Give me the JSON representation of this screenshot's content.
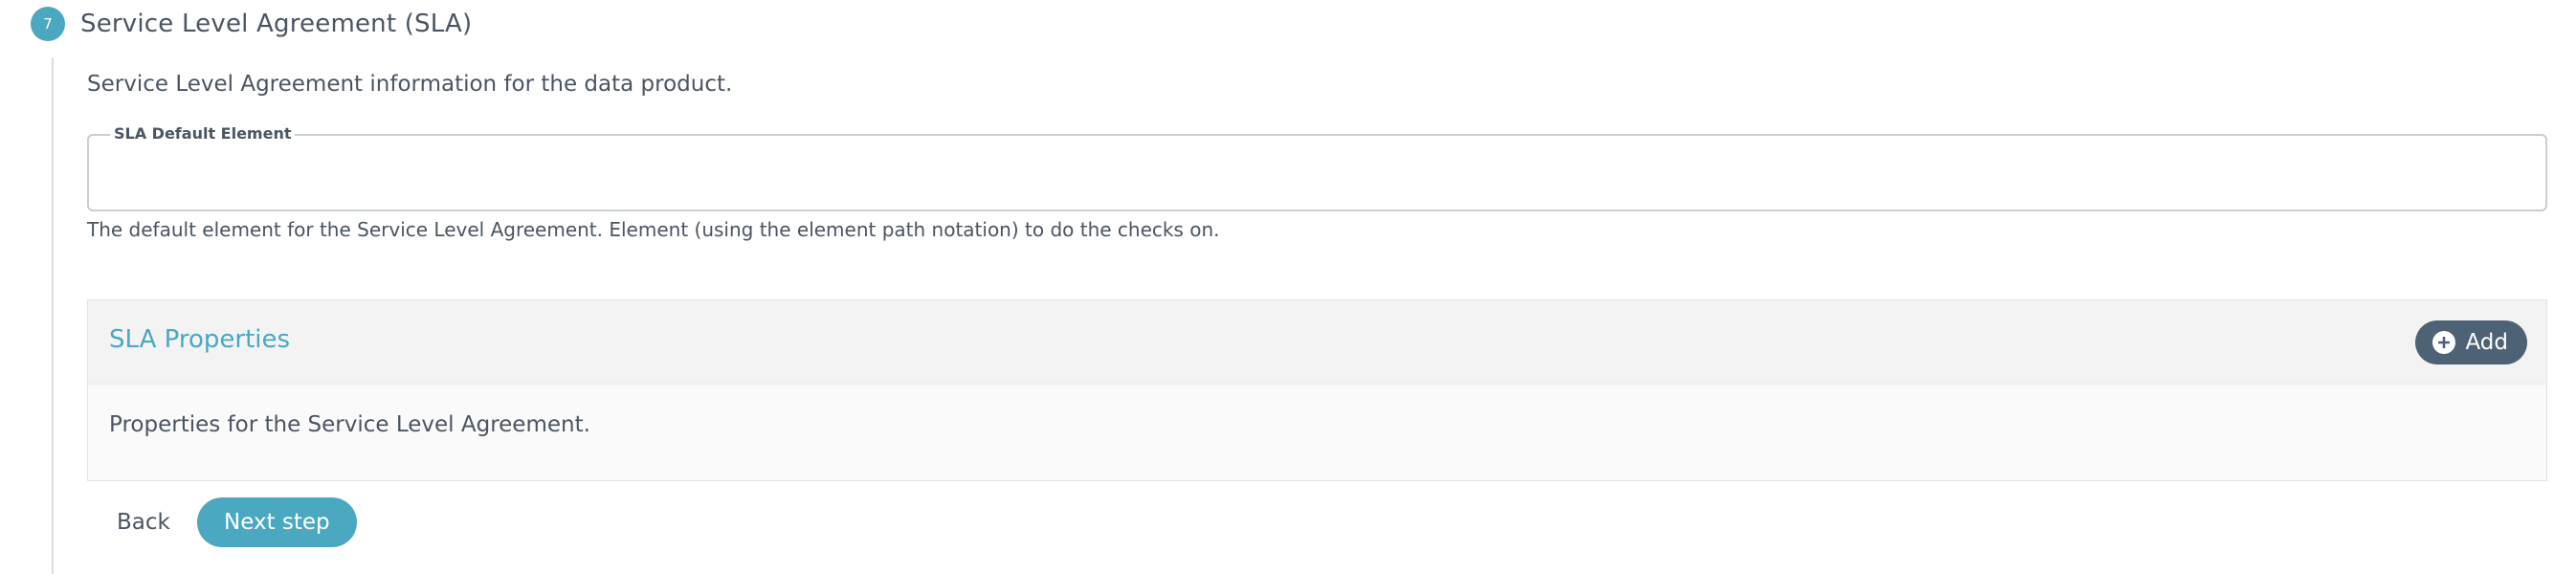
{
  "step": {
    "number": "7",
    "title": "Service Level Agreement (SLA)",
    "description": "Service Level Agreement information for the data product."
  },
  "sla_default_element": {
    "label": "SLA Default Element",
    "value": "",
    "help": "The default element for the Service Level Agreement. Element (using the element path notation) to do the checks on."
  },
  "sla_properties": {
    "title": "SLA Properties",
    "add_label": "Add",
    "add_icon": "plus-circle-icon",
    "description": "Properties for the Service Level Agreement."
  },
  "actions": {
    "back_label": "Back",
    "next_label": "Next step"
  },
  "colors": {
    "accent": "#4aa8c0",
    "add_button": "#4e6275",
    "text": "#4a5563"
  }
}
